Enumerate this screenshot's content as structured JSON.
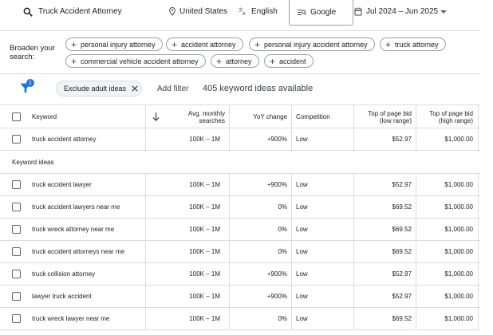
{
  "search": {
    "query": "Truck Accident Attorney",
    "location": "United States",
    "language": "English",
    "engine": "Google",
    "date_range": "Jul 2024 – Jun 2025"
  },
  "broaden": {
    "label": "Broaden your search:",
    "chips": [
      "personal injury attorney",
      "accident attorney",
      "personal injury accident attorney",
      "truck attorney",
      "commercial vehicle accident attorney",
      "attorney",
      "accident"
    ]
  },
  "filters": {
    "badge_count": "1",
    "active_chip": "Exclude adult ideas",
    "add_filter": "Add filter",
    "ideas_count": "405 keyword ideas available"
  },
  "table": {
    "headers": {
      "keyword": "Keyword",
      "searches": "Avg. monthly searches",
      "yoy": "YoY change",
      "competition": "Competition",
      "bid_low": "Top of page bid (low range)",
      "bid_high": "Top of page bid (high range)"
    },
    "provided": {
      "keyword": "truck accident attorney",
      "searches": "100K – 1M",
      "yoy": "+900%",
      "competition": "Low",
      "bid_low": "$52.97",
      "bid_high": "$1,000.00"
    },
    "section_label": "Keyword ideas",
    "rows": [
      {
        "keyword": "truck accident lawyer",
        "searches": "100K – 1M",
        "yoy": "+900%",
        "competition": "Low",
        "bid_low": "$52.97",
        "bid_high": "$1,000.00"
      },
      {
        "keyword": "truck accident lawyers near me",
        "searches": "100K – 1M",
        "yoy": "0%",
        "competition": "Low",
        "bid_low": "$69.52",
        "bid_high": "$1,000.00"
      },
      {
        "keyword": "truck wreck attorney near me",
        "searches": "100K – 1M",
        "yoy": "0%",
        "competition": "Low",
        "bid_low": "$69.52",
        "bid_high": "$1,000.00"
      },
      {
        "keyword": "truck accident attorneys near me",
        "searches": "100K – 1M",
        "yoy": "0%",
        "competition": "Low",
        "bid_low": "$69.52",
        "bid_high": "$1,000.00"
      },
      {
        "keyword": "truck collision attorney",
        "searches": "100K – 1M",
        "yoy": "+900%",
        "competition": "Low",
        "bid_low": "$52.97",
        "bid_high": "$1,000.00"
      },
      {
        "keyword": "lawyer truck accident",
        "searches": "100K – 1M",
        "yoy": "+900%",
        "competition": "Low",
        "bid_low": "$52.97",
        "bid_high": "$1,000.00"
      },
      {
        "keyword": "truck wreck lawyer near me",
        "searches": "100K – 1M",
        "yoy": "0%",
        "competition": "Low",
        "bid_low": "$69.52",
        "bid_high": "$1,000.00"
      }
    ]
  },
  "colors": {
    "accent": "#1a73e8",
    "divider": "#dadce0"
  },
  "icons": [
    "search-icon",
    "location-pin-icon",
    "translate-icon",
    "search-engine-icon",
    "calendar-icon",
    "chevron-down-icon",
    "plus-icon",
    "filter-icon",
    "close-icon",
    "sort-arrow-icon"
  ]
}
